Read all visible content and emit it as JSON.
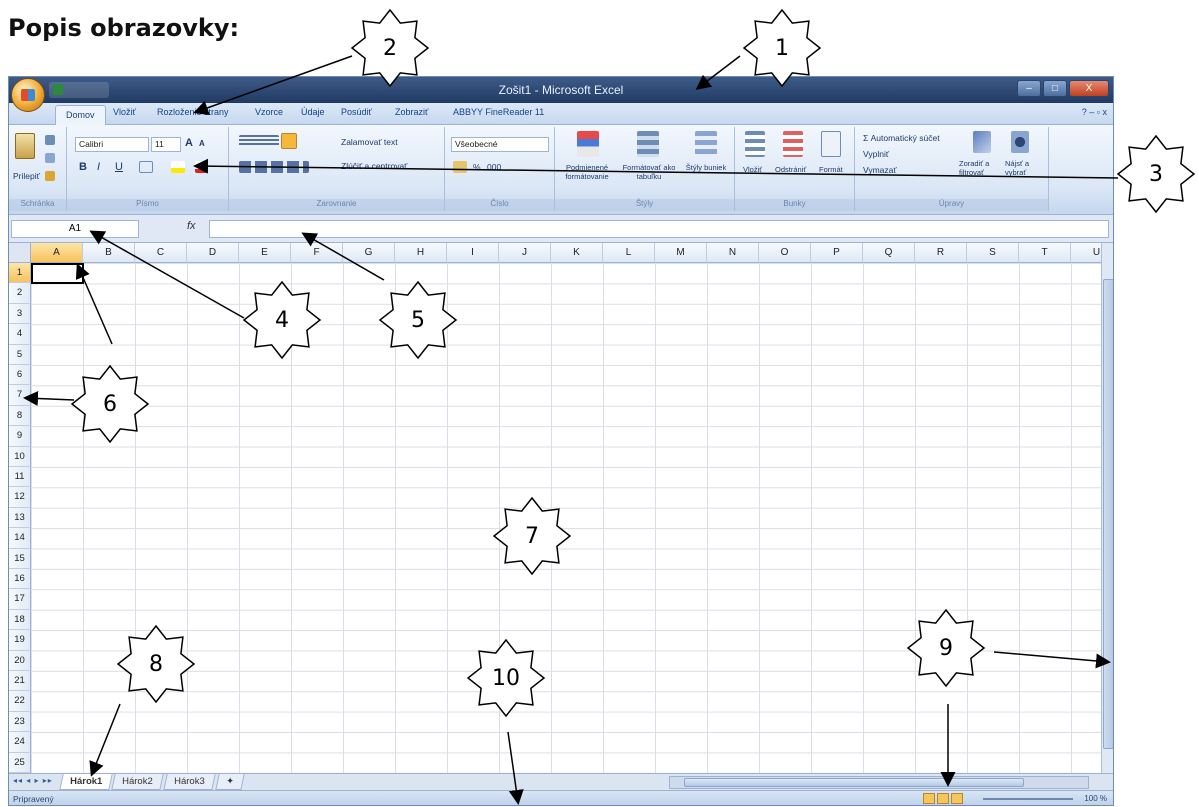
{
  "heading": "Popis obrazovky:",
  "window": {
    "title": "Zošit1 - Microsoft Excel",
    "controls": {
      "minimize": "–",
      "maximize": "□",
      "close": "X"
    }
  },
  "tabs": [
    "Domov",
    "Vložiť",
    "Rozloženie strany",
    "Vzorce",
    "Údaje",
    "Posúdiť",
    "Zobraziť",
    "ABBYY FineReader 11"
  ],
  "active_tab": "Domov",
  "help_controls": "? – ▫ x",
  "ribbon": {
    "clipboard": {
      "paste": "Prilepiť",
      "label": "Schránka"
    },
    "font": {
      "family": "Calibri",
      "size": "11",
      "grow": "A",
      "shrink": "A",
      "bold": "B",
      "italic": "I",
      "underline": "U",
      "label": "Písmo"
    },
    "alignment": {
      "wrap": "Zalamovať text",
      "merge": "Zlúčiť a centrovať",
      "label": "Zarovnanie"
    },
    "number": {
      "format": "Všeobecné",
      "percent": "%",
      "thousands": "000",
      "label": "Číslo"
    },
    "styles": {
      "conditional": "Podmienené formátovanie",
      "as_table": "Formátovať ako tabuľku",
      "cell_styles": "Štýly buniek",
      "label": "Štýly"
    },
    "cells": {
      "insert": "Vložiť",
      "delete": "Odstrániť",
      "format": "Formát",
      "label": "Bunky"
    },
    "editing": {
      "autosum": "Σ Automatický súčet",
      "fill": "Vyplniť",
      "clear": "Vymazať",
      "sort": "Zoradiť a filtrovať",
      "find": "Nájsť a vybrať",
      "label": "Úpravy"
    }
  },
  "formula_bar": {
    "name_box": "A1",
    "fx": "fx",
    "value": ""
  },
  "columns": [
    "A",
    "B",
    "C",
    "D",
    "E",
    "F",
    "G",
    "H",
    "I",
    "J",
    "K",
    "L",
    "M",
    "N",
    "O",
    "P",
    "Q",
    "R",
    "S",
    "T",
    "U"
  ],
  "rows": [
    "1",
    "2",
    "3",
    "4",
    "5",
    "6",
    "7",
    "8",
    "9",
    "10",
    "11",
    "12",
    "13",
    "14",
    "15",
    "16",
    "17",
    "18",
    "19",
    "20",
    "21",
    "22",
    "23",
    "24",
    "25"
  ],
  "active_cell": "A1",
  "sheets": [
    "Hárok1",
    "Hárok2",
    "Hárok3"
  ],
  "sheet_nav": "◂◂ ◂ ▸ ▸▸",
  "status": "Pripravený",
  "zoom": "100 %",
  "callouts": [
    "1",
    "2",
    "3",
    "4",
    "5",
    "6",
    "7",
    "8",
    "9",
    "10"
  ]
}
